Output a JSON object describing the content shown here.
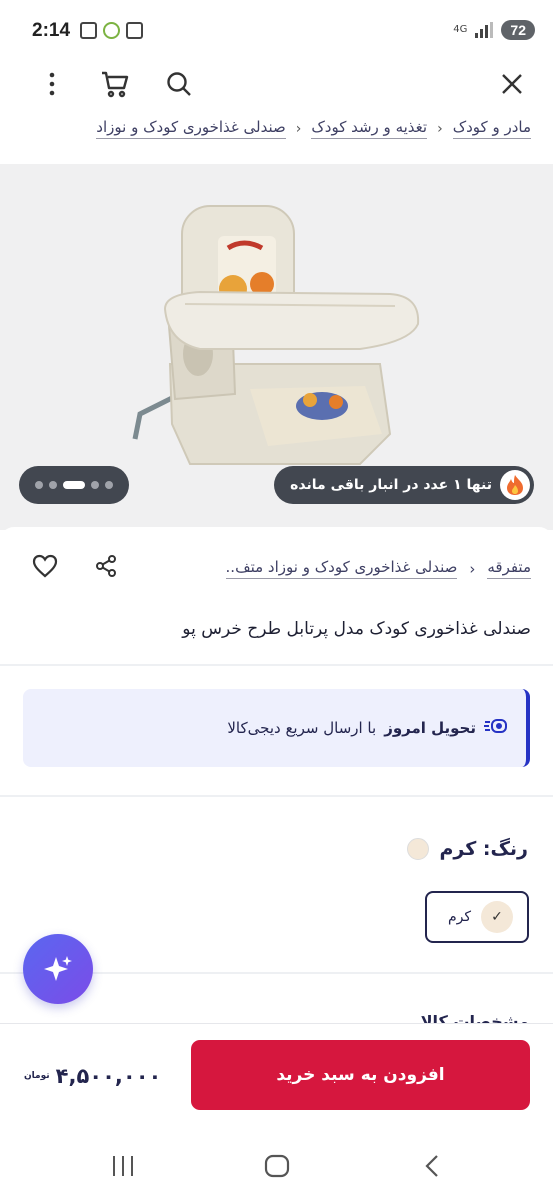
{
  "status_bar": {
    "time": "2:14",
    "network": "4G",
    "battery": "72"
  },
  "toolbar": {
    "icons": [
      "close-icon",
      "search-icon",
      "cart-icon",
      "more-icon"
    ]
  },
  "breadcrumb": {
    "items": [
      "مادر و کودک",
      "تغذیه و رشد کودک",
      "صندلی غذاخوری کودک و نوزاد"
    ]
  },
  "gallery": {
    "stock_notice": "تنها ۱ عدد در انبار باقی مانده",
    "slide_count": 5,
    "active_slide": 3
  },
  "product": {
    "breadcrumb": [
      "متفرقه",
      "صندلی غذاخوری کودک و نوزاد متف.."
    ],
    "title": "صندلی غذاخوری کودک مدل پرتابل طرح خرس پو"
  },
  "delivery": {
    "bold": "تحویل امروز",
    "text": "با ارسال سریع دیجی‌کالا"
  },
  "color": {
    "label": "رنگ:",
    "value": "کرم",
    "option": "کرم",
    "swatch_hex": "#f4e8d8"
  },
  "partial_section_title": "مشخصات کالا",
  "bottom": {
    "buy_label": "افزودن به سبد خرید",
    "price": "۴,۵۰۰,۰۰۰",
    "currency": "تومان"
  },
  "colors": {
    "accent": "#d6173e",
    "primary_text": "#23254e",
    "delivery_bg": "#eef0fd",
    "delivery_border": "#2633c4"
  }
}
